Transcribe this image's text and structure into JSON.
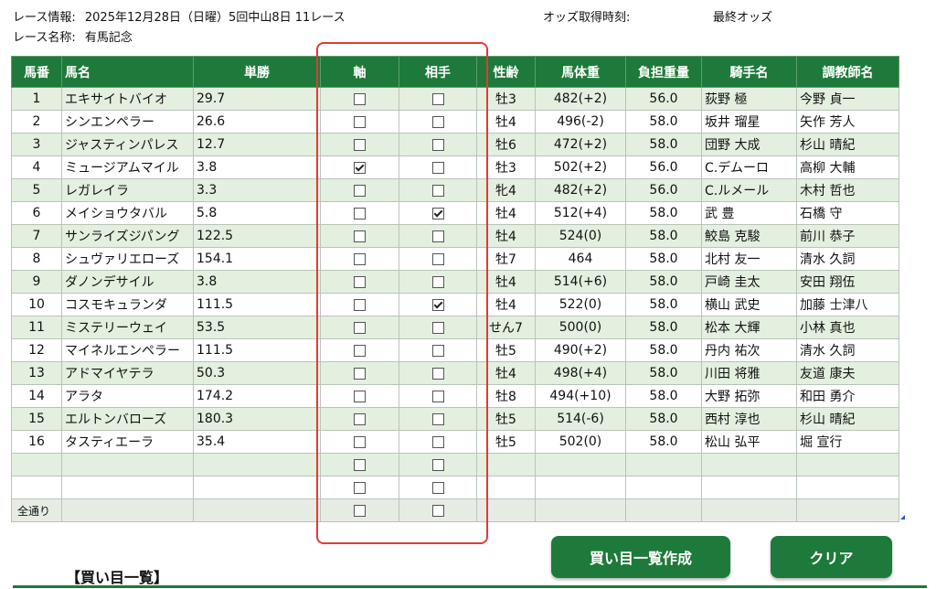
{
  "race_info": {
    "info_label": "レース情報:",
    "info_value": "2025年12月28日（日曜）5回中山8日 11レース",
    "name_label": "レース名称:",
    "name_value": "有馬記念",
    "odds_time_label": "オッズ取得時刻:",
    "odds_time_value": "最終オッズ"
  },
  "headers": [
    "馬番",
    "馬名",
    "単勝",
    "軸",
    "相手",
    "性齢",
    "馬体重",
    "負担重量",
    "騎手名",
    "調教師名"
  ],
  "horses": [
    {
      "num": "1",
      "name": "エキサイトバイオ",
      "odds": "29.7",
      "jiku": false,
      "aite": false,
      "sex": "牡3",
      "weight": "482(+2)",
      "load": "56.0",
      "jockey": "荻野 極",
      "trainer": "今野 貞一"
    },
    {
      "num": "2",
      "name": "シンエンペラー",
      "odds": "26.6",
      "jiku": false,
      "aite": false,
      "sex": "牡4",
      "weight": "496(-2)",
      "load": "58.0",
      "jockey": "坂井 瑠星",
      "trainer": "矢作 芳人"
    },
    {
      "num": "3",
      "name": "ジャスティンパレス",
      "odds": "12.7",
      "jiku": false,
      "aite": false,
      "sex": "牡6",
      "weight": "472(+2)",
      "load": "58.0",
      "jockey": "団野 大成",
      "trainer": "杉山 晴紀"
    },
    {
      "num": "4",
      "name": "ミュージアムマイル",
      "odds": "3.8",
      "jiku": true,
      "aite": false,
      "sex": "牡3",
      "weight": "502(+2)",
      "load": "56.0",
      "jockey": "C.デムーロ",
      "trainer": "高柳 大輔"
    },
    {
      "num": "5",
      "name": "レガレイラ",
      "odds": "3.3",
      "jiku": false,
      "aite": false,
      "sex": "牝4",
      "weight": "482(+2)",
      "load": "56.0",
      "jockey": "C.ルメール",
      "trainer": "木村 哲也"
    },
    {
      "num": "6",
      "name": "メイショウタバル",
      "odds": "5.8",
      "jiku": false,
      "aite": true,
      "sex": "牡4",
      "weight": "512(+4)",
      "load": "58.0",
      "jockey": "武 豊",
      "trainer": "石橋 守"
    },
    {
      "num": "7",
      "name": "サンライズジパング",
      "odds": "122.5",
      "jiku": false,
      "aite": false,
      "sex": "牡4",
      "weight": "524(0)",
      "load": "58.0",
      "jockey": "鮫島 克駿",
      "trainer": "前川 恭子"
    },
    {
      "num": "8",
      "name": "シュヴァリエローズ",
      "odds": "154.1",
      "jiku": false,
      "aite": false,
      "sex": "牡7",
      "weight": "464",
      "load": "58.0",
      "jockey": "北村 友一",
      "trainer": "清水 久詞"
    },
    {
      "num": "9",
      "name": "ダノンデサイル",
      "odds": "3.8",
      "jiku": false,
      "aite": false,
      "sex": "牡4",
      "weight": "514(+6)",
      "load": "58.0",
      "jockey": "戸崎 圭太",
      "trainer": "安田 翔伍"
    },
    {
      "num": "10",
      "name": "コスモキュランダ",
      "odds": "111.5",
      "jiku": false,
      "aite": true,
      "sex": "牡4",
      "weight": "522(0)",
      "load": "58.0",
      "jockey": "横山 武史",
      "trainer": "加藤 士津八"
    },
    {
      "num": "11",
      "name": "ミステリーウェイ",
      "odds": "53.5",
      "jiku": false,
      "aite": false,
      "sex": "せん7",
      "weight": "500(0)",
      "load": "58.0",
      "jockey": "松本 大輝",
      "trainer": "小林 真也"
    },
    {
      "num": "12",
      "name": "マイネルエンペラー",
      "odds": "111.5",
      "jiku": false,
      "aite": false,
      "sex": "牡5",
      "weight": "490(+2)",
      "load": "58.0",
      "jockey": "丹内 祐次",
      "trainer": "清水 久詞"
    },
    {
      "num": "13",
      "name": "アドマイヤテラ",
      "odds": "50.3",
      "jiku": false,
      "aite": false,
      "sex": "牡4",
      "weight": "498(+4)",
      "load": "58.0",
      "jockey": "川田 将雅",
      "trainer": "友道 康夫"
    },
    {
      "num": "14",
      "name": "アラタ",
      "odds": "174.2",
      "jiku": false,
      "aite": false,
      "sex": "牡8",
      "weight": "494(+10)",
      "load": "58.0",
      "jockey": "大野 拓弥",
      "trainer": "和田 勇介"
    },
    {
      "num": "15",
      "name": "エルトンバローズ",
      "odds": "180.3",
      "jiku": false,
      "aite": false,
      "sex": "牡5",
      "weight": "514(-6)",
      "load": "58.0",
      "jockey": "西村 淳也",
      "trainer": "杉山 晴紀"
    },
    {
      "num": "16",
      "name": "タスティエーラ",
      "odds": "35.4",
      "jiku": false,
      "aite": false,
      "sex": "牡5",
      "weight": "502(0)",
      "load": "58.0",
      "jockey": "松山 弘平",
      "trainer": "堀 宣行"
    }
  ],
  "empty_rows": 2,
  "total_label": "全通り",
  "buttons": {
    "create": "買い目一覧作成",
    "clear": "クリア"
  },
  "list_heading": "【買い目一覧】",
  "colors": {
    "header_green": "#1e7a3a",
    "row_light_green": "#e3efdf",
    "highlight_red": "#e53935"
  }
}
